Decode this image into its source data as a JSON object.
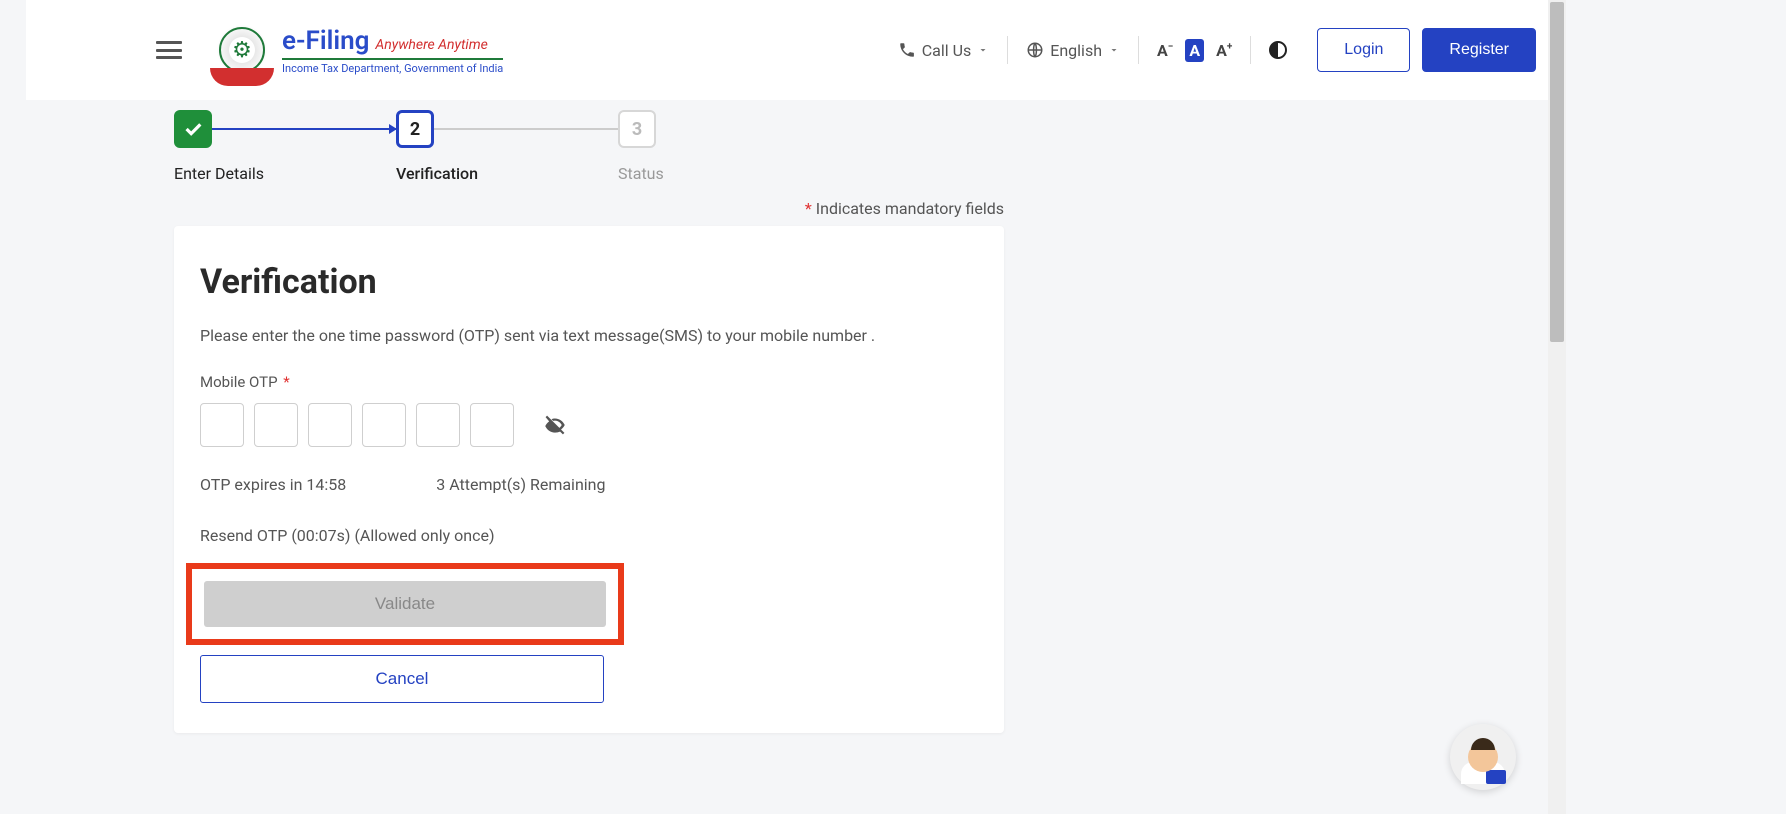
{
  "header": {
    "brand_main": "e-Filing",
    "brand_tag": "Anywhere Anytime",
    "brand_sub": "Income Tax Department, Government of India",
    "call_us": "Call Us",
    "language": "English",
    "login": "Login",
    "register": "Register"
  },
  "stepper": {
    "step2_num": "2",
    "step3_num": "3",
    "label1": "Enter Details",
    "label2": "Verification",
    "label3": "Status"
  },
  "mandatory": "Indicates mandatory fields",
  "card": {
    "title": "Verification",
    "lead": "Please enter the one time password (OTP) sent via text message(SMS) to your mobile number .",
    "otp_label": "Mobile OTP",
    "expires": "OTP expires in 14:58",
    "attempts": "3 Attempt(s) Remaining",
    "resend": "Resend OTP (00:07s)  (Allowed only once)",
    "validate": "Validate",
    "cancel": "Cancel"
  }
}
